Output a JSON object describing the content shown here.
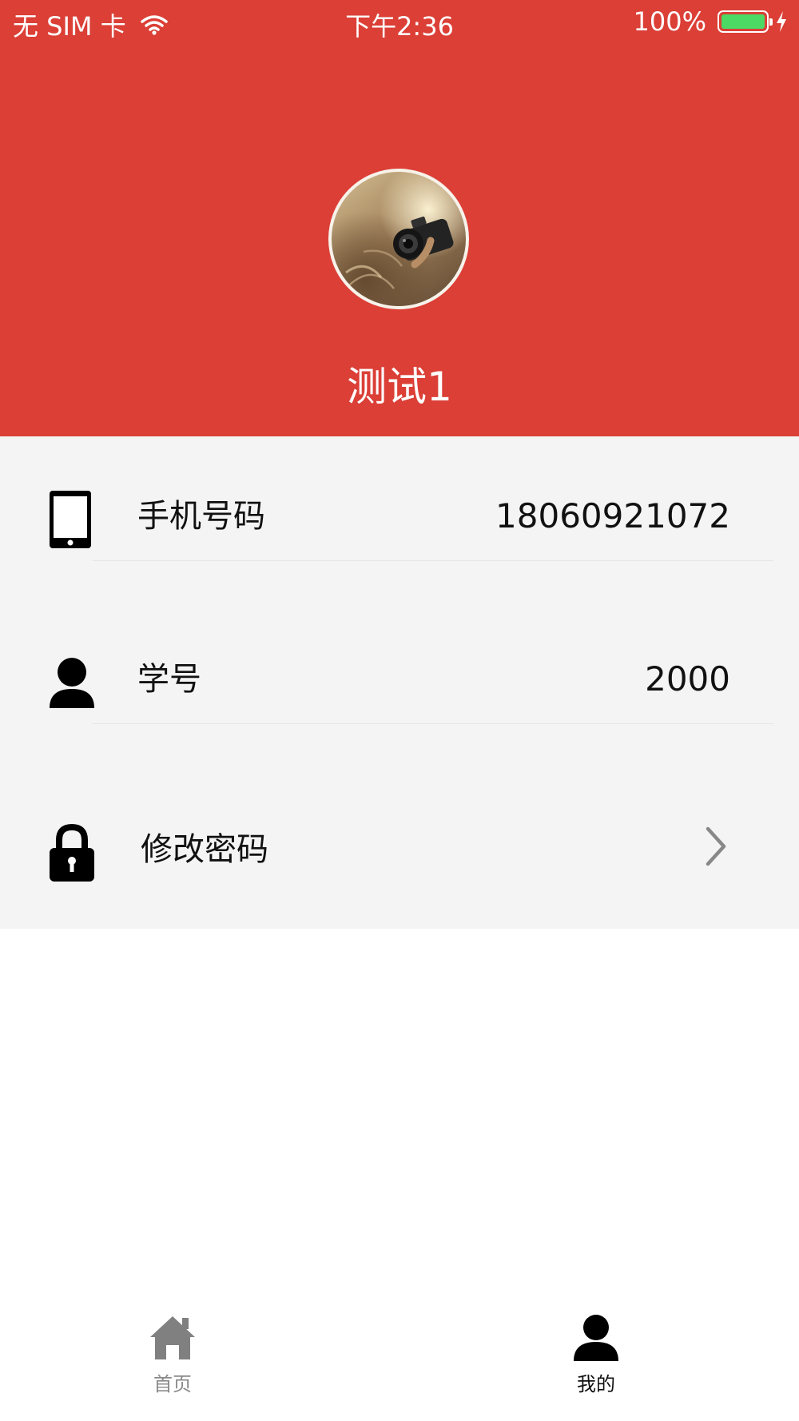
{
  "status_bar": {
    "carrier": "无 SIM 卡",
    "time": "下午2:36",
    "battery": "100%",
    "battery_level": 1.0,
    "battery_color": "#4cd964"
  },
  "theme": {
    "header_color": "#db3f36",
    "panel_color": "#f4f4f4"
  },
  "profile": {
    "avatar_icon": "camera-photo-avatar",
    "username": "测试1"
  },
  "info_rows": [
    {
      "icon": "phone-icon",
      "label": "手机号码",
      "value": "18060921072"
    },
    {
      "icon": "person-icon",
      "label": "学号",
      "value": "2000"
    },
    {
      "icon": "lock-icon",
      "label": "修改密码",
      "action_icon": "chevron-right-icon"
    }
  ],
  "tab_bar": {
    "tabs": [
      {
        "label": "首页",
        "icon": "home-icon",
        "active": false
      },
      {
        "label": "我的",
        "icon": "person-icon",
        "active": true
      }
    ]
  }
}
